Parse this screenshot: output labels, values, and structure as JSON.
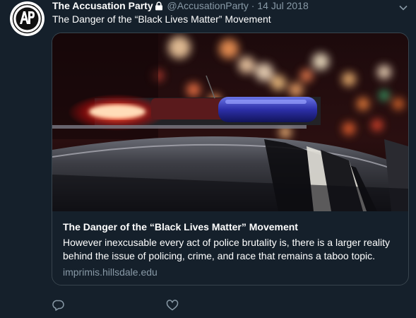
{
  "tweet": {
    "author_name": "The Accusation Party",
    "author_handle": "@AccusationParty",
    "separator": "·",
    "date": "14 Jul 2018",
    "text": "The Danger of the “Black Lives Matter” Movement",
    "icons": {
      "avatar": "accusation-party-logo",
      "lock": "lock-icon",
      "menu": "chevron-down-icon",
      "reply": "reply-icon",
      "like": "heart-icon"
    }
  },
  "card": {
    "title": "The Danger of the “Black Lives Matter” Movement",
    "description": "However inexcusable every act of police brutality is, there is a larger reality behind the issue of policing, crime, and race that remains a taboo topic.",
    "domain": "imprimis.hillsdale.edu"
  },
  "colors": {
    "background": "#15202b",
    "border": "#38444d",
    "muted_text": "#8899a6"
  }
}
